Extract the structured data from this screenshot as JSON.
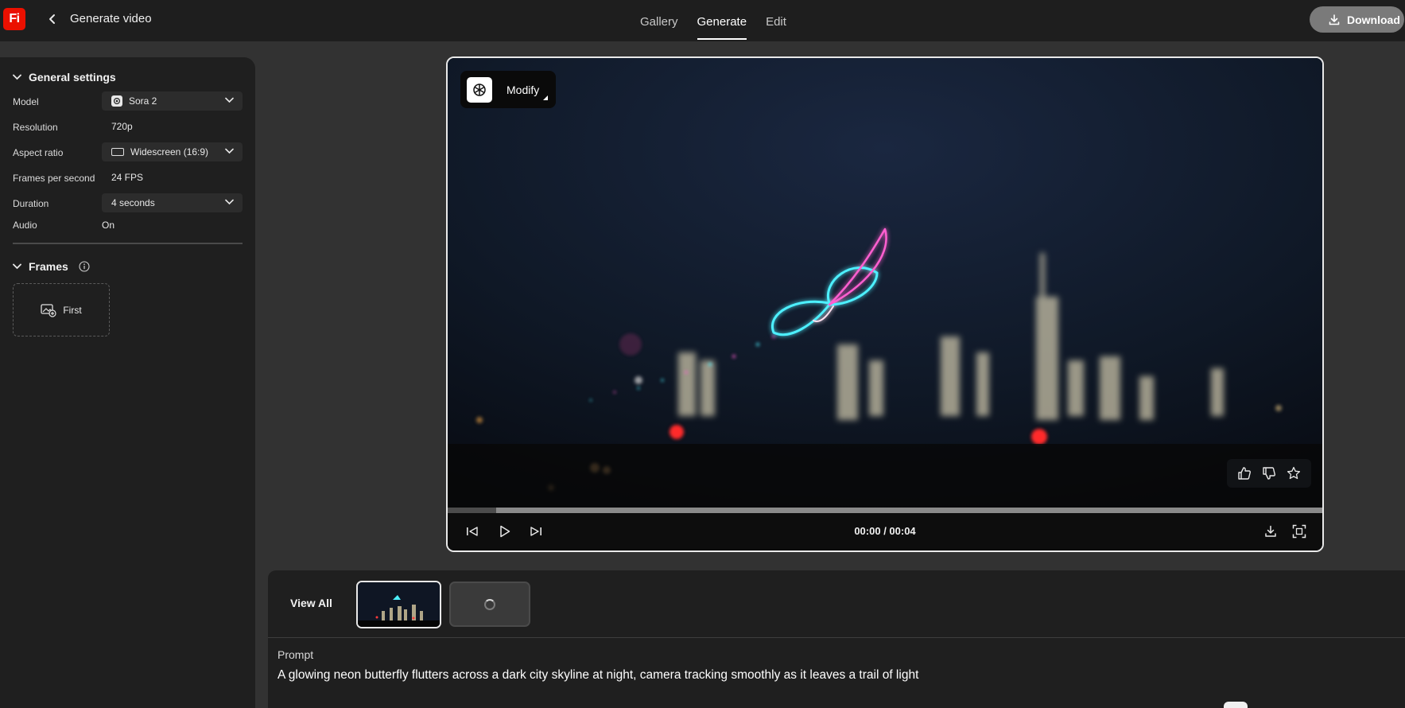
{
  "header": {
    "logo_text": "Fi",
    "title": "Generate video",
    "tabs": [
      {
        "label": "Gallery",
        "active": false
      },
      {
        "label": "Generate",
        "active": true
      },
      {
        "label": "Edit",
        "active": false
      }
    ],
    "download_label": "Download"
  },
  "sidebar": {
    "general_settings_title": "General settings",
    "settings": {
      "model": {
        "label": "Model",
        "value": "Sora 2"
      },
      "resolution": {
        "label": "Resolution",
        "value": "720p"
      },
      "aspect_ratio": {
        "label": "Aspect ratio",
        "value": "Widescreen (16:9)"
      },
      "fps": {
        "label": "Frames per second",
        "value": "24 FPS"
      },
      "duration": {
        "label": "Duration",
        "value": "4 seconds"
      },
      "audio": {
        "label": "Audio",
        "value": "On"
      }
    },
    "frames_title": "Frames",
    "frames": {
      "first_label": "First"
    }
  },
  "player": {
    "modify_label": "Modify",
    "timecode": "00:00 / 00:04",
    "progress_buffered": 0.055
  },
  "bottom": {
    "view_all_label": "View All",
    "prompt_label": "Prompt",
    "prompt_text": "A glowing neon butterfly flutters across a dark city skyline at night, camera tracking smoothly as it leaves a trail of light"
  },
  "colors": {
    "brand": "#eb1000",
    "neon_cyan": "#4df0ff",
    "neon_pink": "#ff5fd0"
  }
}
